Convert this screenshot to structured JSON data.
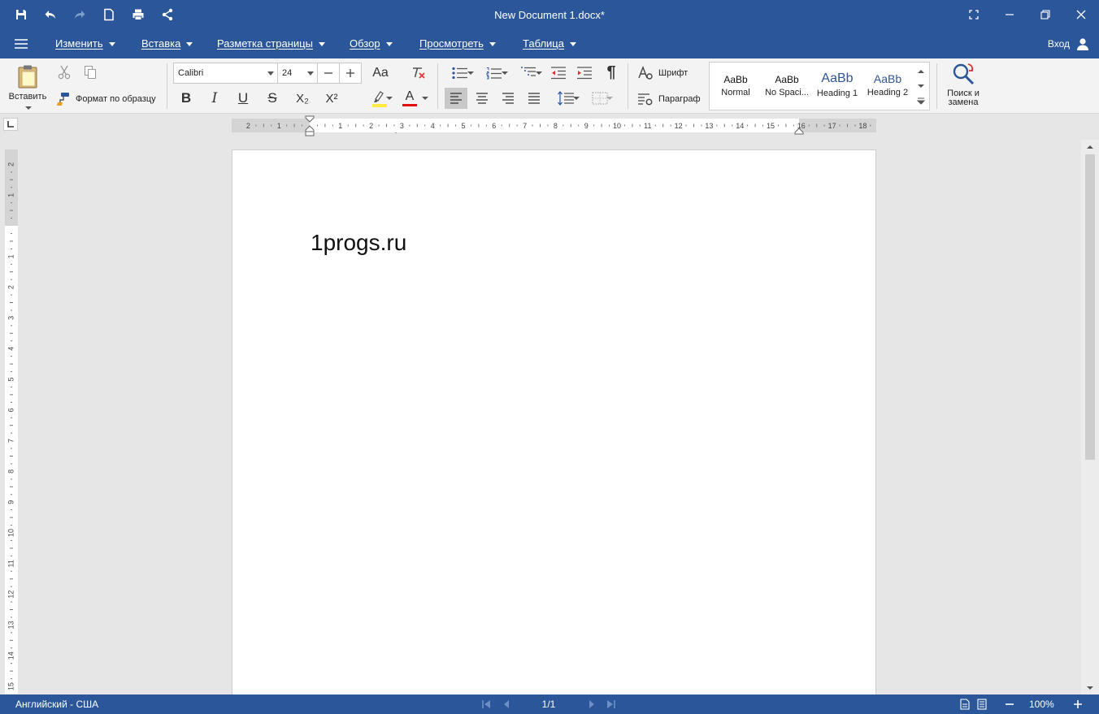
{
  "titlebar": {
    "title": "New Document 1.docx*"
  },
  "menu": {
    "items": [
      {
        "label": "Изменить"
      },
      {
        "label": "Вставка"
      },
      {
        "label": "Разметка страницы"
      },
      {
        "label": "Обзор"
      },
      {
        "label": "Просмотреть"
      },
      {
        "label": "Таблица"
      }
    ],
    "login_label": "Вход"
  },
  "ribbon": {
    "paste_label": "Вставить",
    "format_painter_label": "Формат по образцу",
    "font_name": "Calibri",
    "font_size": "24",
    "font_dialog_label": "Шрифт",
    "paragraph_dialog_label": "Параграф",
    "bold_glyph": "B",
    "italic_glyph": "I",
    "underline_glyph": "U",
    "strike_glyph": "S",
    "subscript_glyph": "X₂",
    "superscript_glyph": "X²",
    "change_case_glyph": "Aa",
    "font_color_glyph": "A",
    "pilcrow_glyph": "¶",
    "highlight_color": "#ffeb3b",
    "font_color": "#e01010",
    "find_replace_label_1": "Поиск и",
    "find_replace_label_2": "замена"
  },
  "styles": [
    {
      "sample": "AaBb",
      "name": "Normal"
    },
    {
      "sample": "AaBb",
      "name": "No Spaci..."
    },
    {
      "sample": "AaBb",
      "name": "Heading 1"
    },
    {
      "sample": "AaBb",
      "name": "Heading 2"
    }
  ],
  "document": {
    "text": "1progs.ru"
  },
  "ruler": {
    "h_labels": [
      "2",
      "1",
      "1",
      "2",
      "3",
      "4",
      "5",
      "6",
      "7",
      "8",
      "9",
      "10",
      "11",
      "12",
      "13",
      "14",
      "15",
      "16",
      "17",
      "18"
    ],
    "v_labels": [
      "2",
      "1",
      "1",
      "2",
      "3",
      "4",
      "5",
      "6",
      "7",
      "8",
      "9",
      "10",
      "11",
      "12",
      "13",
      "14",
      "15"
    ]
  },
  "statusbar": {
    "language": "Английский - США",
    "page_indicator": "1/1",
    "zoom": "100%"
  },
  "colors": {
    "accent": "#2b579a",
    "ribbon_bg": "#f3f3f3",
    "workspace_bg": "#e6e6e6"
  }
}
